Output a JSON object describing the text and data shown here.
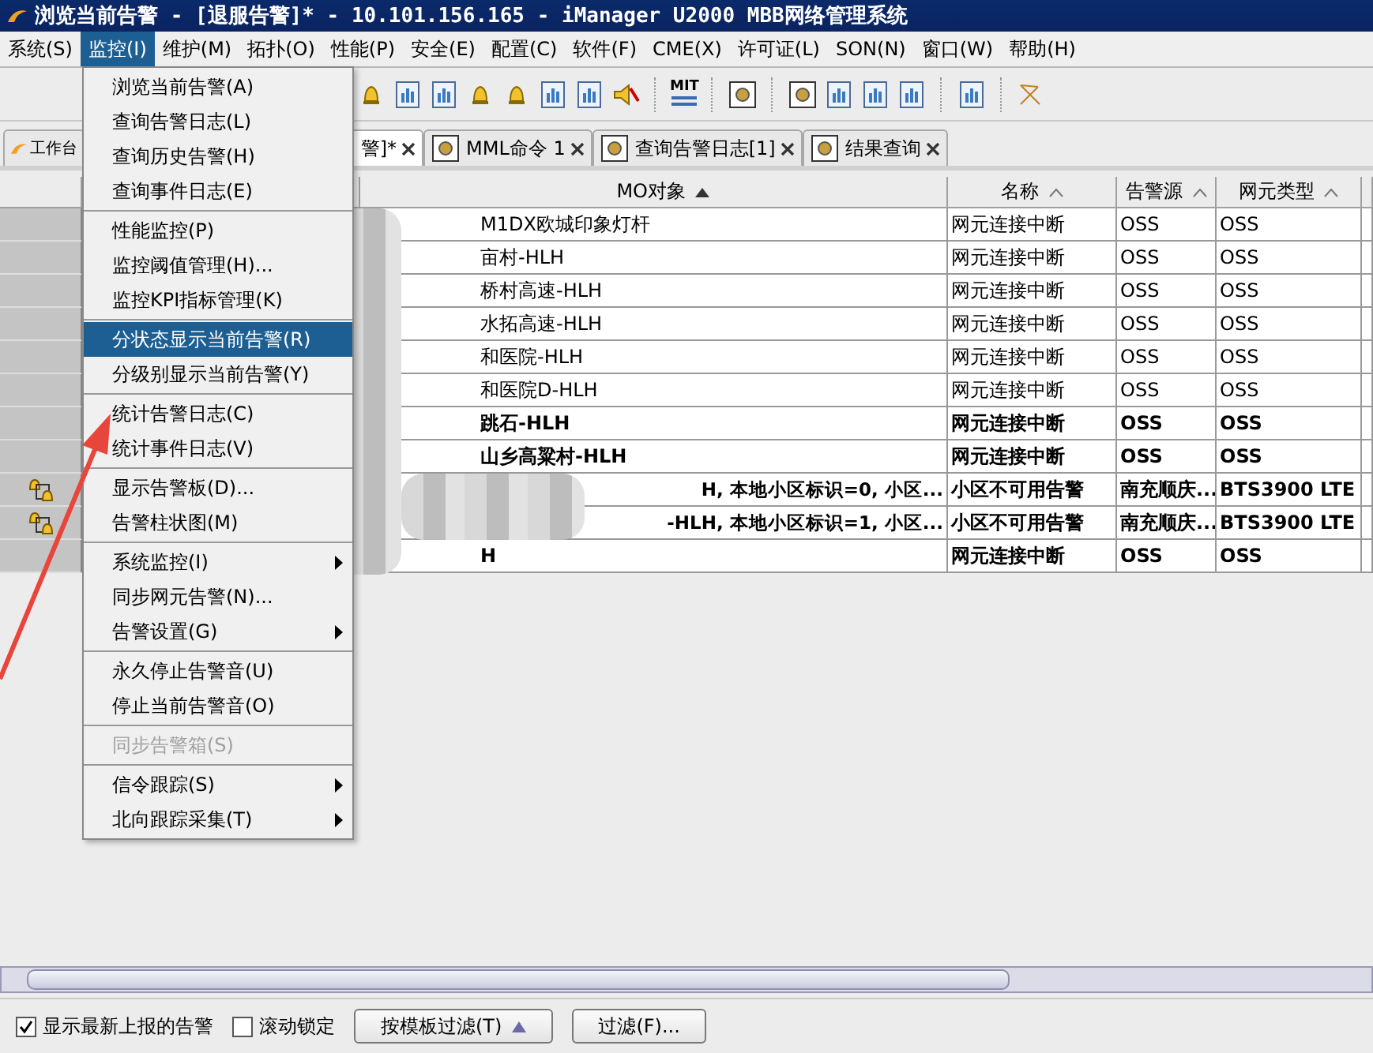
{
  "window": {
    "title": "浏览当前告警 - [退服告警]* - 10.101.156.165 - iManager U2000 MBB网络管理系统"
  },
  "menu_bar": [
    {
      "label": "系统(S)",
      "selected": false
    },
    {
      "label": "监控(I)",
      "selected": true
    },
    {
      "label": "维护(M)",
      "selected": false
    },
    {
      "label": "拓扑(O)",
      "selected": false
    },
    {
      "label": "性能(P)",
      "selected": false
    },
    {
      "label": "安全(E)",
      "selected": false
    },
    {
      "label": "配置(C)",
      "selected": false
    },
    {
      "label": "软件(F)",
      "selected": false
    },
    {
      "label": "CME(X)",
      "selected": false
    },
    {
      "label": "许可证(L)",
      "selected": false
    },
    {
      "label": "SON(N)",
      "selected": false
    },
    {
      "label": "窗口(W)",
      "selected": false
    },
    {
      "label": "帮助(H)",
      "selected": false
    }
  ],
  "toolbar": {
    "mit_label": "MIT"
  },
  "tabs": [
    {
      "label": "工作台",
      "selected": false,
      "closable": false
    },
    {
      "label": "警]*",
      "selected": true,
      "closable": true
    },
    {
      "label": "MML命令 1",
      "selected": false,
      "closable": true
    },
    {
      "label": "查询告警日志[1]",
      "selected": false,
      "closable": true
    },
    {
      "label": "结果查询",
      "selected": false,
      "closable": true
    }
  ],
  "dropdown_menu": [
    [
      {
        "label": "浏览当前告警(A)",
        "selected": false,
        "disabled": false,
        "submenu": false
      },
      {
        "label": "查询告警日志(L)",
        "selected": false,
        "disabled": false,
        "submenu": false
      },
      {
        "label": "查询历史告警(H)",
        "selected": false,
        "disabled": false,
        "submenu": false
      },
      {
        "label": "查询事件日志(E)",
        "selected": false,
        "disabled": false,
        "submenu": false
      }
    ],
    [
      {
        "label": "性能监控(P)",
        "selected": false,
        "disabled": false,
        "submenu": false
      },
      {
        "label": "监控阈值管理(H)...",
        "selected": false,
        "disabled": false,
        "submenu": false
      },
      {
        "label": "监控KPI指标管理(K)",
        "selected": false,
        "disabled": false,
        "submenu": false
      }
    ],
    [
      {
        "label": "分状态显示当前告警(R)",
        "selected": true,
        "disabled": false,
        "submenu": false
      },
      {
        "label": "分级别显示当前告警(Y)",
        "selected": false,
        "disabled": false,
        "submenu": false
      }
    ],
    [
      {
        "label": "统计告警日志(C)",
        "selected": false,
        "disabled": false,
        "submenu": false
      },
      {
        "label": "统计事件日志(V)",
        "selected": false,
        "disabled": false,
        "submenu": false
      }
    ],
    [
      {
        "label": "显示告警板(D)...",
        "selected": false,
        "disabled": false,
        "submenu": false
      },
      {
        "label": "告警柱状图(M)",
        "selected": false,
        "disabled": false,
        "submenu": false
      }
    ],
    [
      {
        "label": "系统监控(I)",
        "selected": false,
        "disabled": false,
        "submenu": true
      },
      {
        "label": "同步网元告警(N)...",
        "selected": false,
        "disabled": false,
        "submenu": false
      },
      {
        "label": "告警设置(G)",
        "selected": false,
        "disabled": false,
        "submenu": true
      }
    ],
    [
      {
        "label": "永久停止告警音(U)",
        "selected": false,
        "disabled": false,
        "submenu": false
      },
      {
        "label": "停止当前告警音(O)",
        "selected": false,
        "disabled": false,
        "submenu": false
      }
    ],
    [
      {
        "label": "同步告警箱(S)",
        "selected": false,
        "disabled": true,
        "submenu": false
      }
    ],
    [
      {
        "label": "信令跟踪(S)",
        "selected": false,
        "disabled": false,
        "submenu": true
      },
      {
        "label": "北向跟踪采集(T)",
        "selected": false,
        "disabled": false,
        "submenu": true
      }
    ]
  ],
  "table": {
    "columns": [
      {
        "label": "MO对象",
        "sorted": true
      },
      {
        "label": "名称",
        "sorted": false
      },
      {
        "label": "告警源",
        "sorted": false
      },
      {
        "label": "网元类型",
        "sorted": false
      }
    ],
    "rows": [
      {
        "mo": "M1DX欧城印象灯杆",
        "name": "网元连接中断",
        "source": "OSS",
        "ne_type": "OSS",
        "bold": false,
        "alarm_icon": false
      },
      {
        "mo": "亩村-HLH",
        "name": "网元连接中断",
        "source": "OSS",
        "ne_type": "OSS",
        "bold": false,
        "alarm_icon": false
      },
      {
        "mo": "桥村高速-HLH",
        "name": "网元连接中断",
        "source": "OSS",
        "ne_type": "OSS",
        "bold": false,
        "alarm_icon": false
      },
      {
        "mo": "水拓高速-HLH",
        "name": "网元连接中断",
        "source": "OSS",
        "ne_type": "OSS",
        "bold": false,
        "alarm_icon": false
      },
      {
        "mo": "和医院-HLH",
        "name": "网元连接中断",
        "source": "OSS",
        "ne_type": "OSS",
        "bold": false,
        "alarm_icon": false
      },
      {
        "mo": "和医院D-HLH",
        "name": "网元连接中断",
        "source": "OSS",
        "ne_type": "OSS",
        "bold": false,
        "alarm_icon": false
      },
      {
        "mo": "跳石-HLH",
        "name": "网元连接中断",
        "source": "OSS",
        "ne_type": "OSS",
        "bold": true,
        "alarm_icon": false
      },
      {
        "mo": "山乡高粱村-HLH",
        "name": "网元连接中断",
        "source": "OSS",
        "ne_type": "OSS",
        "bold": true,
        "alarm_icon": false
      },
      {
        "mo": "H, 本地小区标识=0, 小区...",
        "name": "小区不可用告警",
        "source": "南充顺庆...",
        "ne_type": "BTS3900 LTE",
        "bold": true,
        "alarm_icon": true
      },
      {
        "mo": "-HLH, 本地小区标识=1, 小区...",
        "name": "小区不可用告警",
        "source": "南充顺庆...",
        "ne_type": "BTS3900 LTE",
        "bold": true,
        "alarm_icon": true
      },
      {
        "mo": "H",
        "name": "网元连接中断",
        "source": "OSS",
        "ne_type": "OSS",
        "bold": true,
        "alarm_icon": false
      }
    ]
  },
  "bottom_bar": {
    "checkboxes": [
      {
        "label": "显示最新上报的告警",
        "checked": true
      },
      {
        "label": "滚动锁定",
        "checked": false
      }
    ],
    "buttons": [
      {
        "label": "按模板过滤(T)",
        "kind": "dropdown"
      },
      {
        "label": "过滤(F)...",
        "kind": "plain"
      }
    ]
  }
}
